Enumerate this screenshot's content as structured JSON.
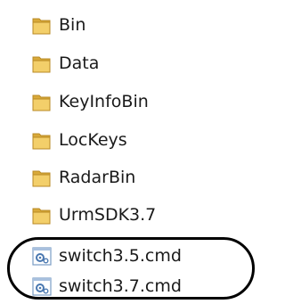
{
  "files": [
    {
      "name": "Bin",
      "type": "folder",
      "icon": "folder-icon"
    },
    {
      "name": "Data",
      "type": "folder",
      "icon": "folder-icon"
    },
    {
      "name": "KeyInfoBin",
      "type": "folder",
      "icon": "folder-icon"
    },
    {
      "name": "LocKeys",
      "type": "folder",
      "icon": "folder-icon"
    },
    {
      "name": "RadarBin",
      "type": "folder",
      "icon": "folder-icon"
    },
    {
      "name": "UrmSDK3.7",
      "type": "folder",
      "icon": "folder-icon"
    },
    {
      "name": "switch3.5.cmd",
      "type": "cmd",
      "icon": "cmd-file-icon"
    },
    {
      "name": "switch3.7.cmd",
      "type": "cmd",
      "icon": "cmd-file-icon"
    }
  ],
  "colors": {
    "folder_back": "#d9a93a",
    "folder_front": "#f3cf6a",
    "folder_edge": "#b88a24",
    "cmd_paper": "#ffffff",
    "cmd_border": "#7a9cc4",
    "cmd_gear": "#4a78b0",
    "highlight_outline": "#000000"
  }
}
